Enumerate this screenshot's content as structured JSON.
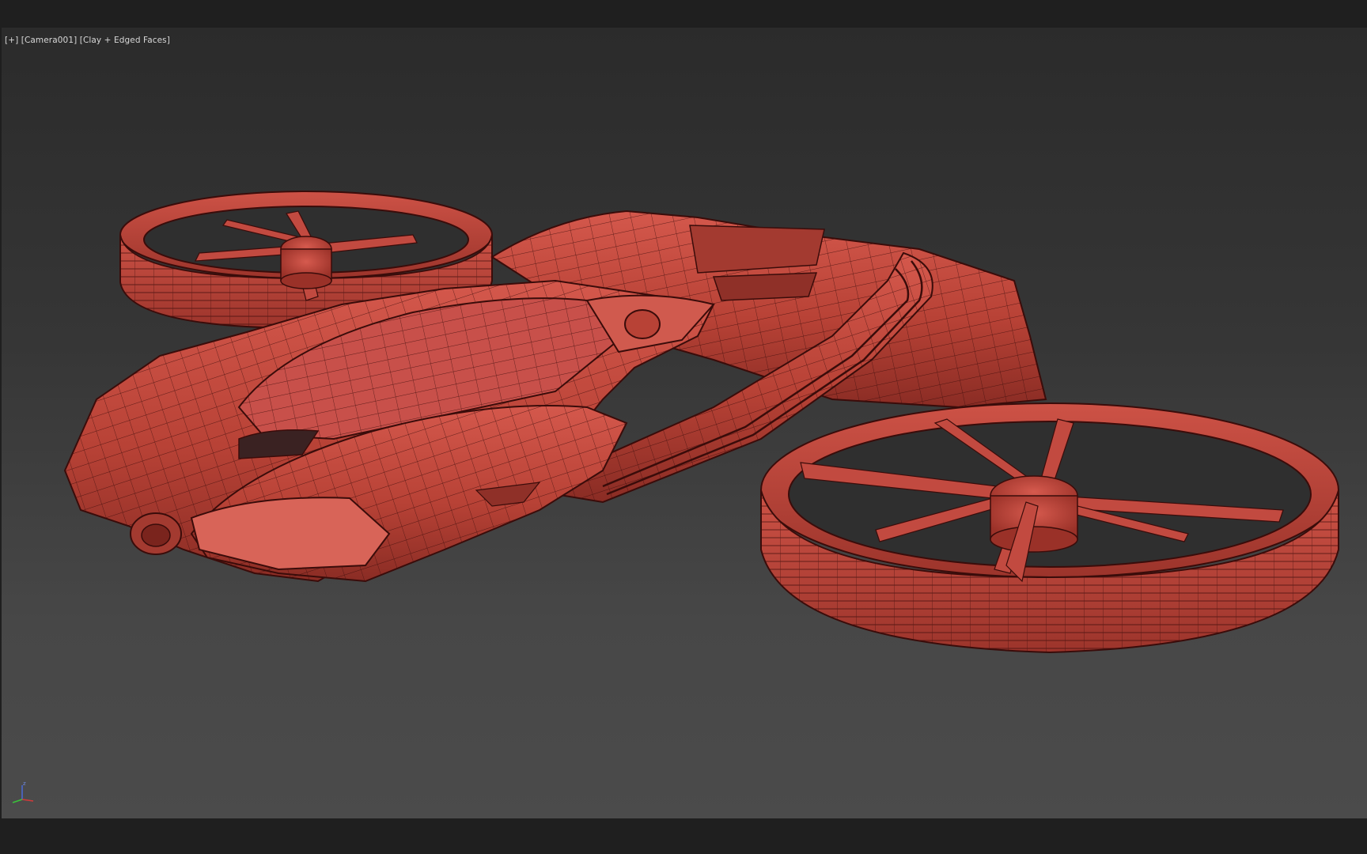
{
  "viewport": {
    "label_plus": "[+]",
    "label_camera": "[Camera001]",
    "label_shading": "[Clay + Edged Faces]",
    "object_color": "#c24a40",
    "wire_color": "#3a0c0a",
    "background_top": "#2b2b2b",
    "background_bottom": "#4b4b4b"
  },
  "gizmo": {
    "axis_z": "z",
    "x_color": "#d23a3a",
    "y_color": "#3ac23a",
    "z_color": "#4a6bd8"
  },
  "icons": {
    "axis": "axis-tripod-icon"
  }
}
